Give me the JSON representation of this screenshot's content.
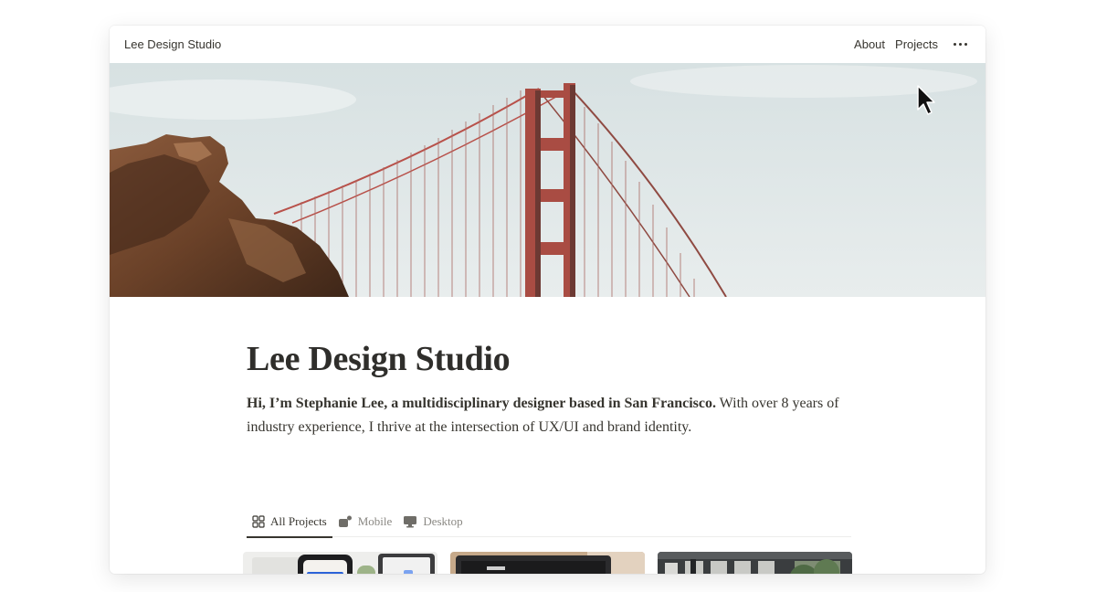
{
  "header": {
    "site_name": "Lee Design Studio",
    "nav": [
      {
        "label": "About"
      },
      {
        "label": "Projects"
      }
    ],
    "more_icon": "more-horizontal-icon"
  },
  "hero": {
    "image": "golden-gate-bridge-photo"
  },
  "page": {
    "title": "Lee Design Studio",
    "intro_bold": "Hi, I’m Stephanie Lee, a multidisciplinary designer based in San Francisco.",
    "intro_rest": " With over 8 years of industry experience, I thrive at the intersection of UX/UI and brand identity."
  },
  "tabs": [
    {
      "label": "All Projects",
      "icon": "grid-icon",
      "active": true
    },
    {
      "label": "Mobile",
      "icon": "mobile-icon",
      "active": false
    },
    {
      "label": "Desktop",
      "icon": "desktop-icon",
      "active": false
    }
  ],
  "gallery": [
    {
      "image": "mobile-app-mockup-photo"
    },
    {
      "image": "desktop-laptop-photo"
    },
    {
      "image": "storefront-photo"
    }
  ],
  "colors": {
    "text": "#37352f",
    "muted": "#8a8883",
    "bridge": "#b8514a",
    "sky": "#dfe6e6"
  }
}
